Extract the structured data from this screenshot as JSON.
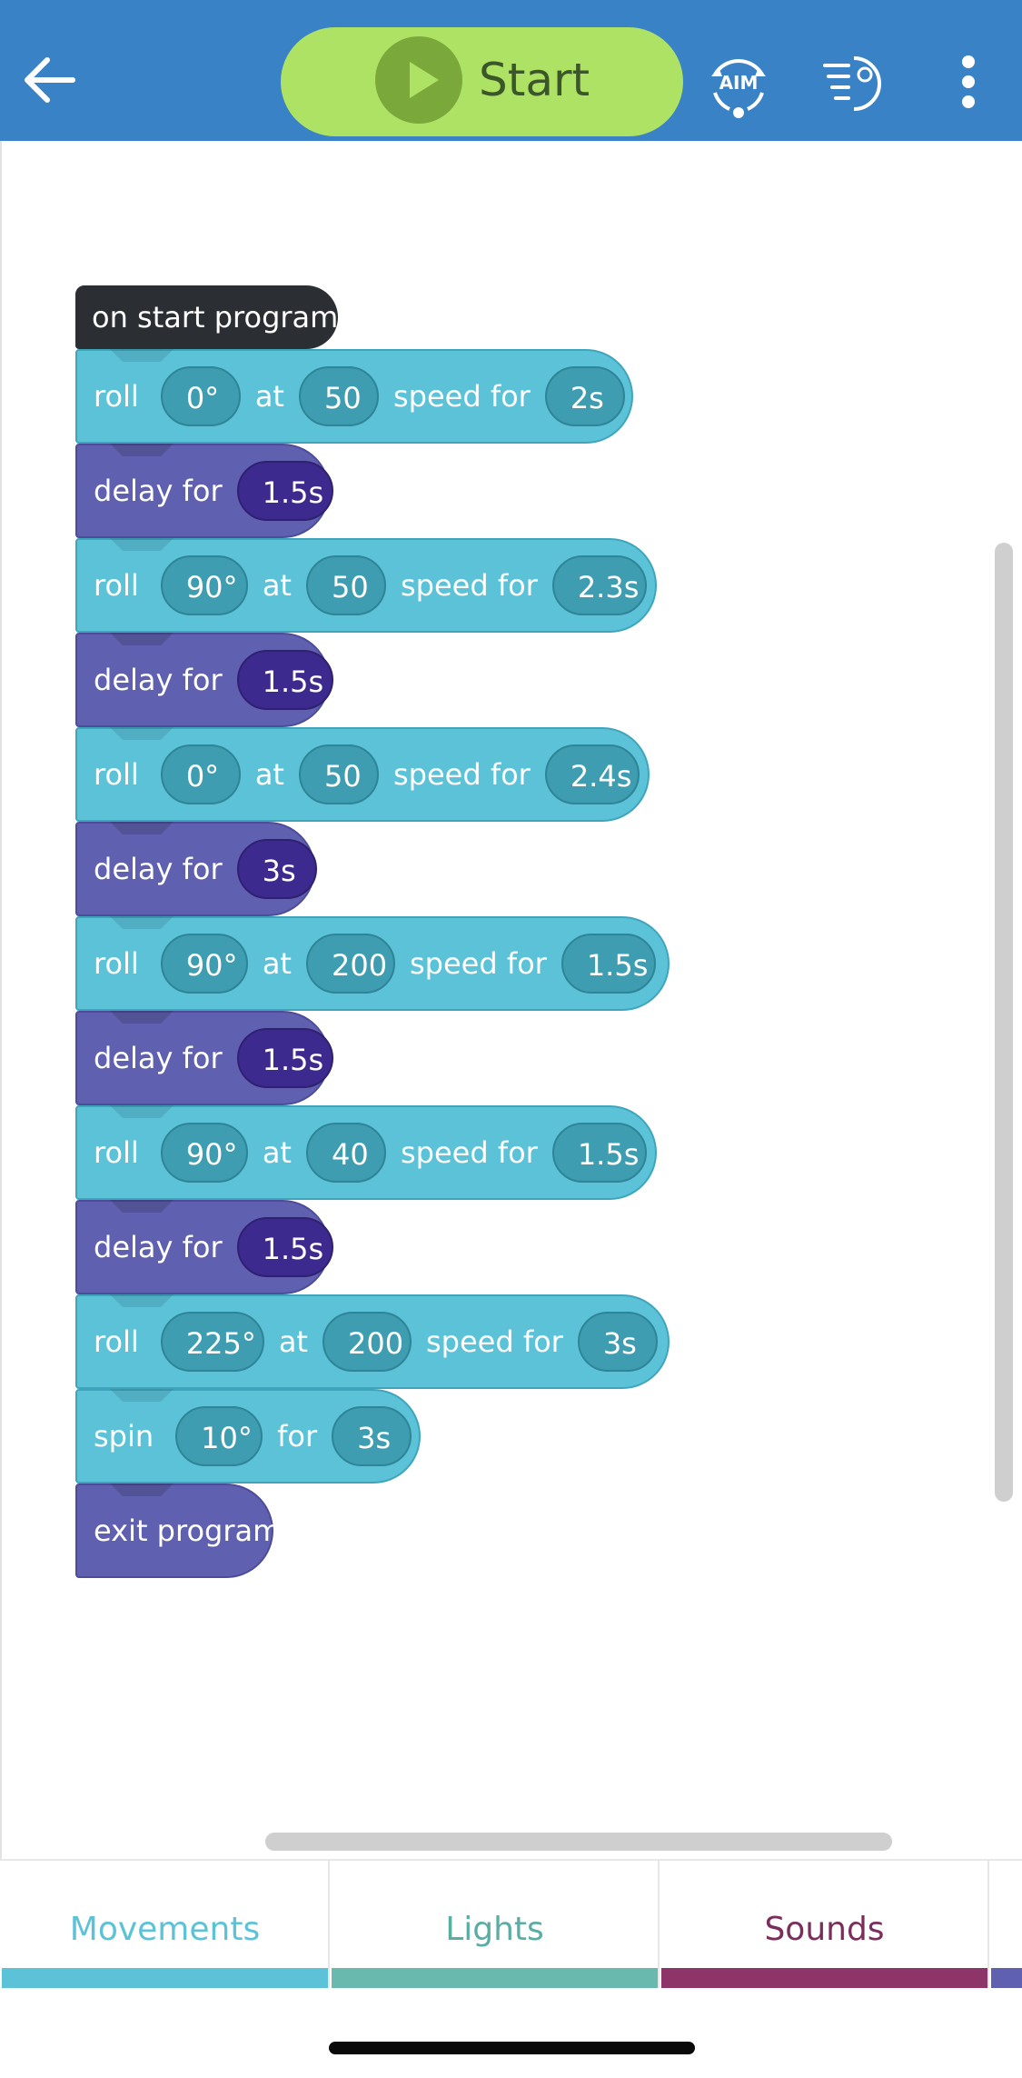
{
  "toolbar": {
    "start_label": "Start",
    "aim_label": "AIM"
  },
  "program": {
    "start_label": "on start program",
    "blocks": [
      {
        "type": "roll",
        "keyword": "roll",
        "heading": "0°",
        "at": "at",
        "speed": "50",
        "speed_for": "speed for",
        "duration": "2s"
      },
      {
        "type": "delay",
        "keyword": "delay for",
        "duration": "1.5s"
      },
      {
        "type": "roll",
        "keyword": "roll",
        "heading": "90°",
        "at": "at",
        "speed": "50",
        "speed_for": "speed for",
        "duration": "2.3s"
      },
      {
        "type": "delay",
        "keyword": "delay for",
        "duration": "1.5s"
      },
      {
        "type": "roll",
        "keyword": "roll",
        "heading": "0°",
        "at": "at",
        "speed": "50",
        "speed_for": "speed for",
        "duration": "2.4s"
      },
      {
        "type": "delay",
        "keyword": "delay for",
        "duration": "3s"
      },
      {
        "type": "roll",
        "keyword": "roll",
        "heading": "90°",
        "at": "at",
        "speed": "200",
        "speed_for": "speed for",
        "duration": "1.5s"
      },
      {
        "type": "delay",
        "keyword": "delay for",
        "duration": "1.5s"
      },
      {
        "type": "roll",
        "keyword": "roll",
        "heading": "90°",
        "at": "at",
        "speed": "40",
        "speed_for": "speed for",
        "duration": "1.5s"
      },
      {
        "type": "delay",
        "keyword": "delay for",
        "duration": "1.5s"
      },
      {
        "type": "roll",
        "keyword": "roll",
        "heading": "225°",
        "at": "at",
        "speed": "200",
        "speed_for": "speed for",
        "duration": "3s"
      },
      {
        "type": "spin",
        "keyword": "spin",
        "angle": "10°",
        "for": "for",
        "duration": "3s"
      },
      {
        "type": "exit",
        "keyword": "exit program"
      }
    ]
  },
  "tabs": [
    {
      "label": "Movements",
      "color": "#5bc2d8",
      "text_color": "#5bc2d8"
    },
    {
      "label": "Lights",
      "color": "#6ab9ae",
      "text_color": "#5aada2"
    },
    {
      "label": "Sounds",
      "color": "#8d3568",
      "text_color": "#7a2e5b"
    },
    {
      "label": "",
      "color": "#6060b0",
      "text_color": "#6060b0"
    }
  ],
  "colors": {
    "topbar": "#3a82c6",
    "start_button": "#aee265",
    "movement_block": "#5bc2d8",
    "control_block": "#6060b0",
    "event_block": "#2b2f33"
  },
  "icons": [
    "back-arrow-icon",
    "play-icon",
    "aim-icon",
    "drive-icon",
    "more-vertical-icon"
  ]
}
